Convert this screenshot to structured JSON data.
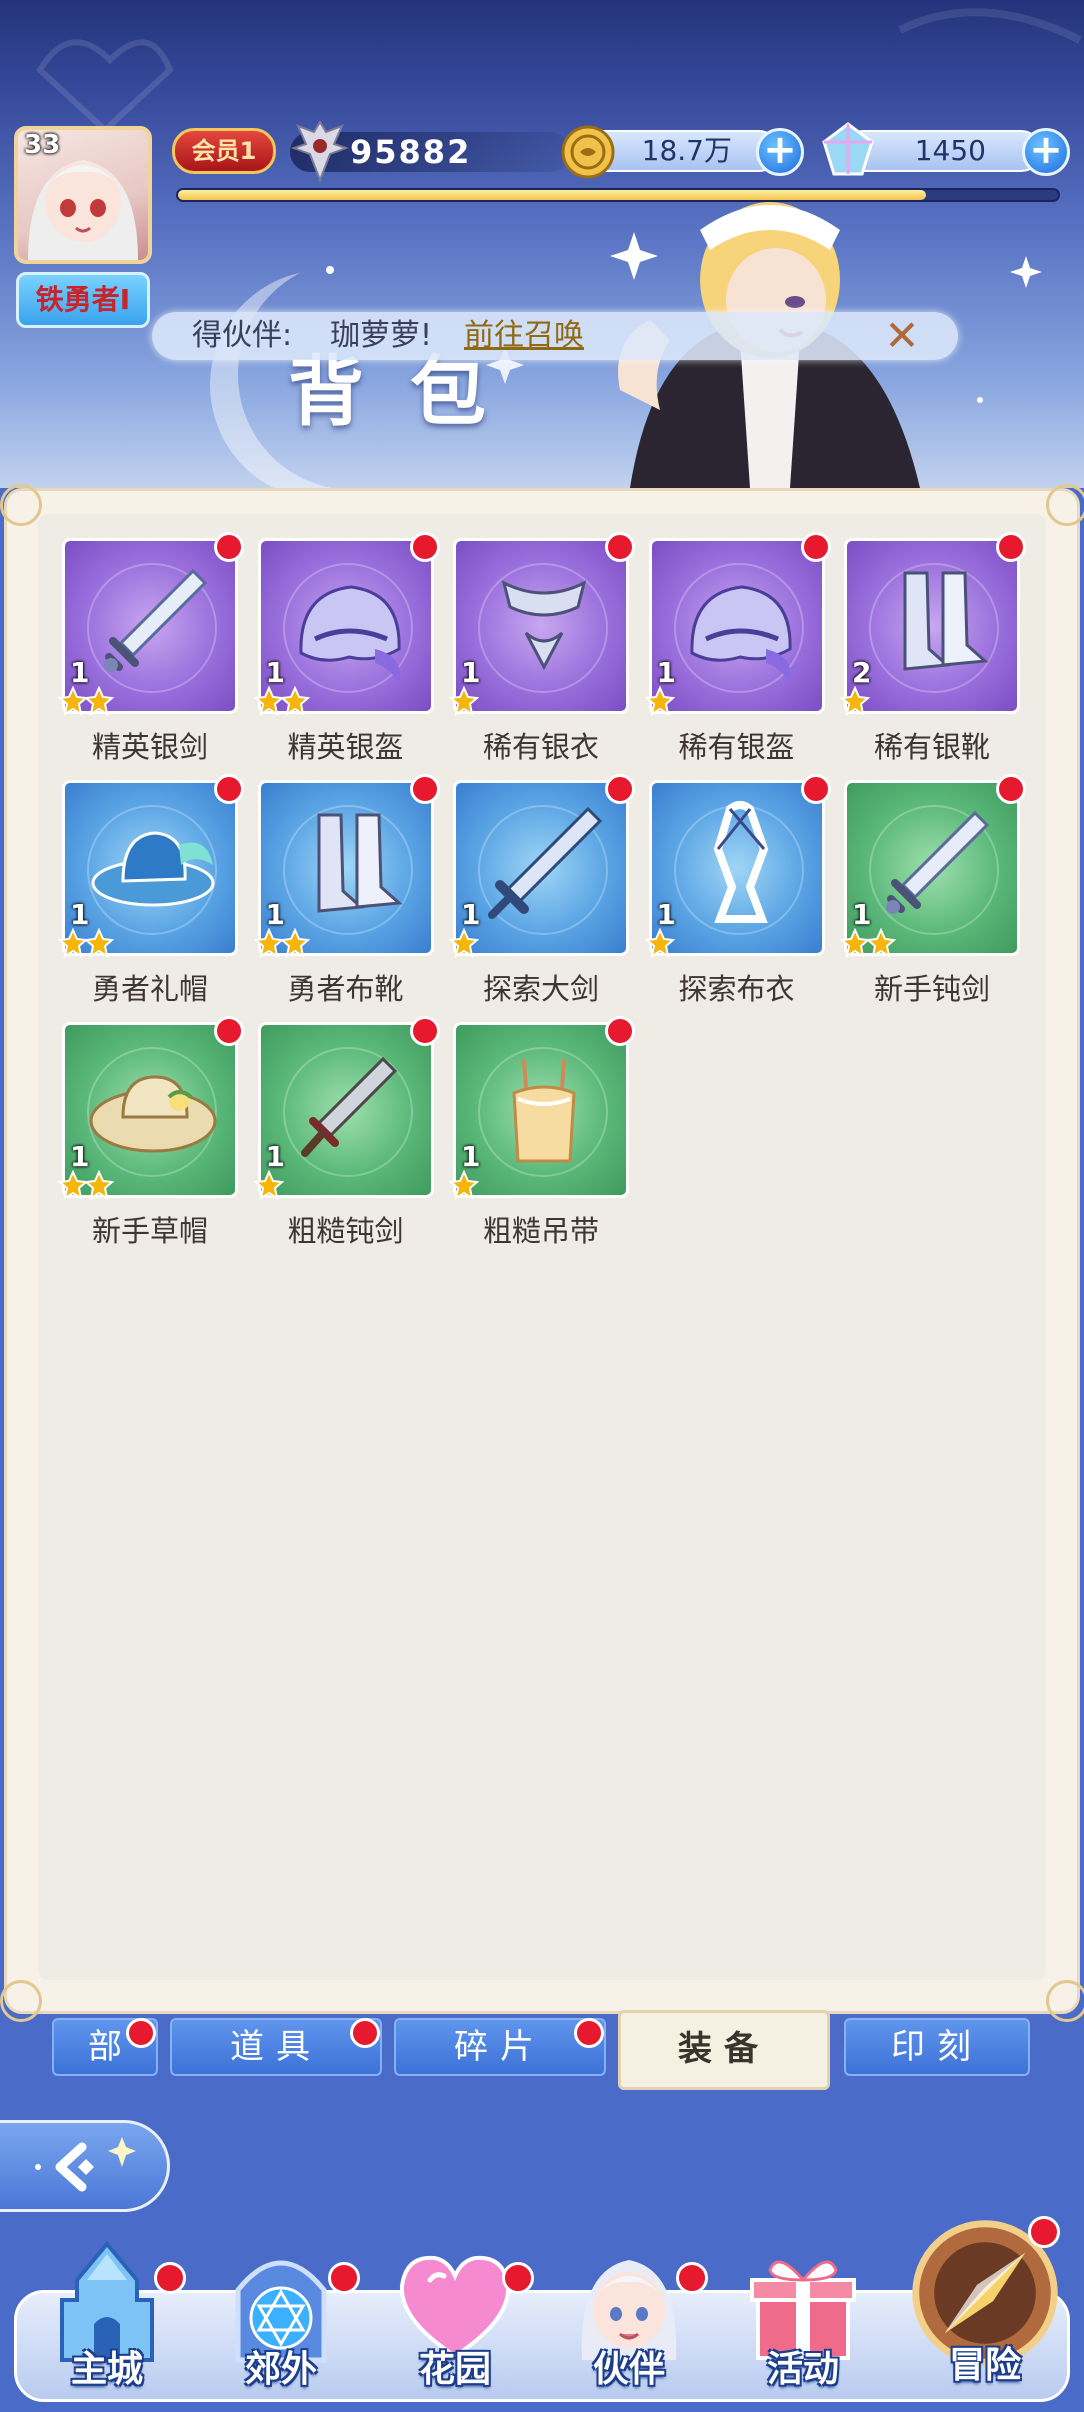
{
  "header": {
    "level": "33",
    "player_title": "铁勇者I",
    "vip_label": "会员1",
    "power": "95882",
    "gold": "18.7万",
    "diamonds": "1450",
    "exp_fraction": 0.85,
    "page_title": "背包"
  },
  "notice": {
    "prefix": "得伙伴:",
    "partner": "珈萝萝!",
    "link": "前往召唤"
  },
  "inventory": {
    "items": [
      {
        "name": "精英银剑",
        "count": "1",
        "stars": 2,
        "quality": "purple",
        "icon": "sword-icon"
      },
      {
        "name": "精英银盔",
        "count": "1",
        "stars": 2,
        "quality": "purple",
        "icon": "helmet-icon"
      },
      {
        "name": "稀有银衣",
        "count": "1",
        "stars": 1,
        "quality": "purple",
        "icon": "armor-icon"
      },
      {
        "name": "稀有银盔",
        "count": "1",
        "stars": 1,
        "quality": "purple",
        "icon": "helmet-icon"
      },
      {
        "name": "稀有银靴",
        "count": "2",
        "stars": 1,
        "quality": "purple",
        "icon": "boots-icon"
      },
      {
        "name": "勇者礼帽",
        "count": "1",
        "stars": 2,
        "quality": "blue",
        "icon": "hat-icon"
      },
      {
        "name": "勇者布靴",
        "count": "1",
        "stars": 2,
        "quality": "blue",
        "icon": "boots-icon"
      },
      {
        "name": "探索大剑",
        "count": "1",
        "stars": 1,
        "quality": "blue",
        "icon": "greatsword-icon"
      },
      {
        "name": "探索布衣",
        "count": "1",
        "stars": 1,
        "quality": "blue",
        "icon": "cloth-icon"
      },
      {
        "name": "新手钝剑",
        "count": "1",
        "stars": 2,
        "quality": "green",
        "icon": "sword-icon"
      },
      {
        "name": "新手草帽",
        "count": "1",
        "stars": 2,
        "quality": "green",
        "icon": "straw-hat-icon"
      },
      {
        "name": "粗糙钝剑",
        "count": "1",
        "stars": 1,
        "quality": "green",
        "icon": "dagger-icon"
      },
      {
        "name": "粗糙吊带",
        "count": "1",
        "stars": 1,
        "quality": "green",
        "icon": "camisole-icon"
      }
    ]
  },
  "tabs": [
    "部",
    "道具",
    "碎片",
    "装备",
    "印刻"
  ],
  "active_tab": "装备",
  "nav": [
    "主城",
    "郊外",
    "花园",
    "伙伴",
    "活动",
    "冒险"
  ],
  "colors": {
    "purple": "#9a6fdc",
    "blue": "#5aa4e4",
    "green": "#5ab879",
    "badge_red": "#e6192e",
    "star_gold": "#f5b50a"
  }
}
